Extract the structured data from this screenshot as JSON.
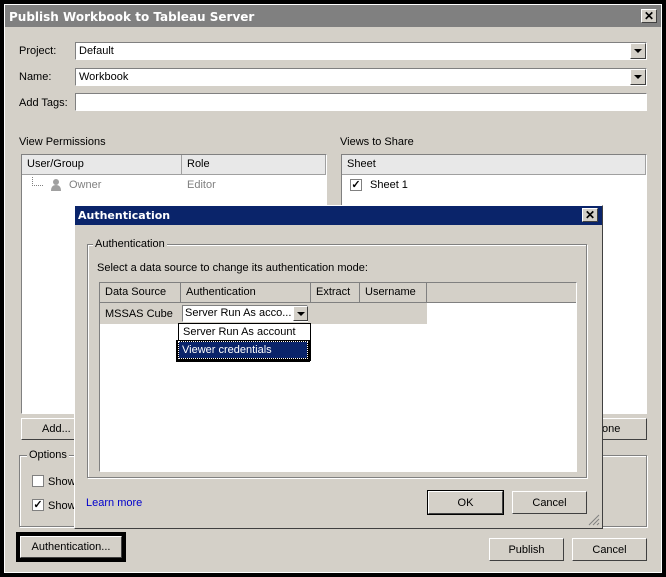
{
  "window": {
    "title": "Publish Workbook to Tableau Server"
  },
  "form": {
    "project_label": "Project:",
    "project_value": "Default",
    "name_label": "Name:",
    "name_value": "Workbook",
    "tags_label": "Add Tags:",
    "tags_value": ""
  },
  "permissions": {
    "section_label": "View Permissions",
    "col_user_group": "User/Group",
    "col_role": "Role",
    "rows": [
      {
        "user": "Owner",
        "role": "Editor"
      }
    ],
    "add_button": "Add..."
  },
  "views": {
    "section_label": "Views to Share",
    "col_sheet": "Sheet",
    "rows": [
      {
        "sheet": "Sheet 1",
        "checked": true
      }
    ],
    "none_button": "one"
  },
  "options": {
    "label": "Options",
    "opt1_label": "Show",
    "opt2_label": "Show",
    "opt1_checked": false,
    "opt2_checked": true
  },
  "footer": {
    "auth_button": "Authentication...",
    "publish_button": "Publish",
    "cancel_button": "Cancel"
  },
  "auth_dialog": {
    "title": "Authentication",
    "group_label": "Authentication",
    "instruction": "Select a data source to change its authentication mode:",
    "columns": [
      "Data Source",
      "Authentication",
      "Extract",
      "Username"
    ],
    "rows": [
      {
        "data_source": "MSSAS Cube",
        "authentication": "Server Run As acco...",
        "extract": "",
        "username": ""
      }
    ],
    "dropdown_options": [
      "Server Run As account",
      "Viewer credentials"
    ],
    "dropdown_selected": "Viewer credentials",
    "learn_more": "Learn more",
    "ok_button": "OK",
    "cancel_button": "Cancel"
  },
  "colors": {
    "dialog_title_bg": "#0a246a",
    "main_title_bg": "#808080",
    "link": "#0000cc",
    "selection": "#0a246a"
  }
}
